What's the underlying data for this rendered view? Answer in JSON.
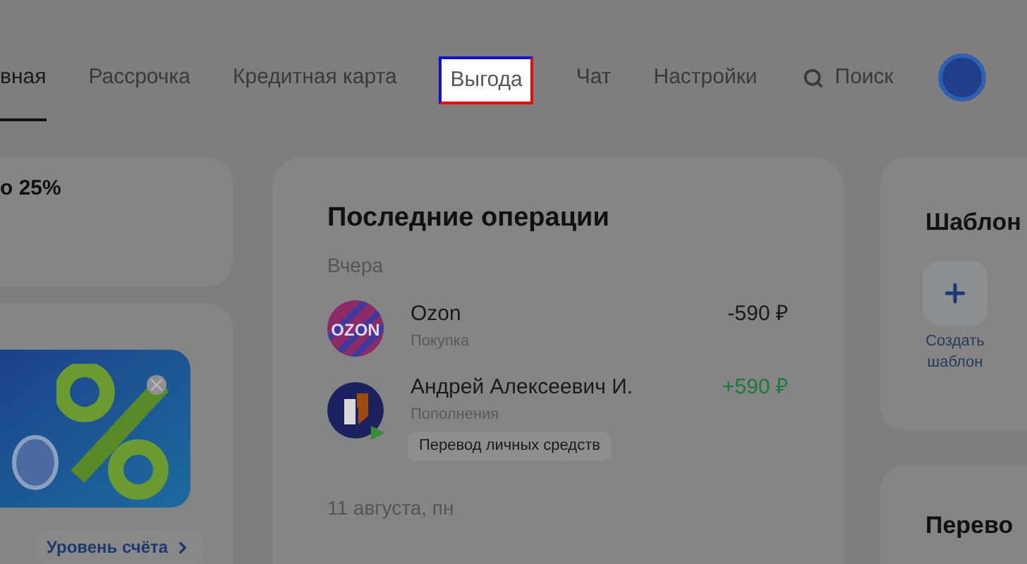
{
  "nav": {
    "tabs": [
      {
        "label": "вная",
        "selected": true,
        "highlighted": false
      },
      {
        "label": "Рассрочка",
        "selected": false,
        "highlighted": false
      },
      {
        "label": "Кредитная карта",
        "selected": false,
        "highlighted": false
      },
      {
        "label": "Выгода",
        "selected": false,
        "highlighted": true
      },
      {
        "label": "Чат",
        "selected": false,
        "highlighted": false
      },
      {
        "label": "Настройки",
        "selected": false,
        "highlighted": false
      }
    ],
    "search": {
      "label": "Поиск"
    }
  },
  "promo_card": {
    "title": "о 25%"
  },
  "level_card": {
    "button": "Уровень счёта"
  },
  "operations": {
    "title": "Последние операции",
    "groups": [
      {
        "date": "Вчера",
        "items": [
          {
            "name": "Ozon",
            "logo": {
              "kind": "ozon",
              "text": "OZON"
            },
            "category": "Покупка",
            "amount": "-590 ₽",
            "kind": "debit"
          },
          {
            "name": "Андрей Алексеевич И.",
            "logo": {
              "kind": "bank"
            },
            "category": "Пополнения",
            "tag": "Перевод личных средств",
            "amount": "+590 ₽",
            "kind": "credit"
          }
        ]
      },
      {
        "date": "11 августа, пн"
      }
    ]
  },
  "templates": {
    "title": "Шаблон",
    "create": "Создать шаблон"
  },
  "transfers": {
    "title": "Перево"
  }
}
